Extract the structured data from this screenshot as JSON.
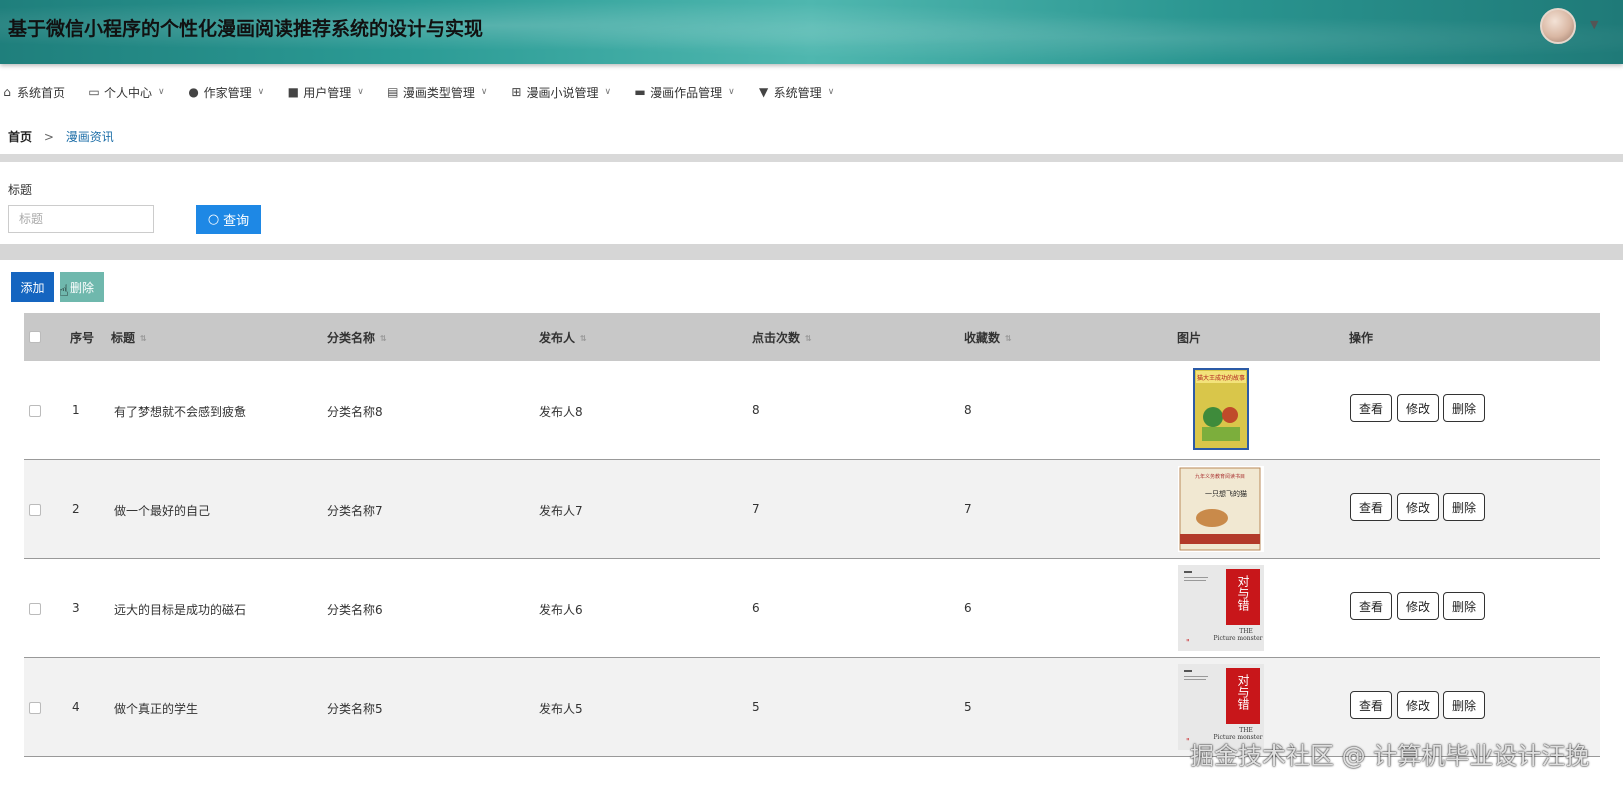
{
  "app": {
    "title": "基于微信小程序的个性化漫画阅读推荐系统的设计与实现"
  },
  "nav": {
    "items": [
      {
        "label": "系统首页",
        "icon": "home-icon",
        "dropdown": false
      },
      {
        "label": "个人中心",
        "icon": "id-card-icon",
        "dropdown": true
      },
      {
        "label": "作家管理",
        "icon": "person-icon",
        "dropdown": true
      },
      {
        "label": "用户管理",
        "icon": "briefcase-icon",
        "dropdown": true
      },
      {
        "label": "漫画类型管理",
        "icon": "clipboard-icon",
        "dropdown": true
      },
      {
        "label": "漫画小说管理",
        "icon": "grid-icon",
        "dropdown": true
      },
      {
        "label": "漫画作品管理",
        "icon": "chat-icon",
        "dropdown": true
      },
      {
        "label": "系统管理",
        "icon": "flag-icon",
        "dropdown": true
      }
    ]
  },
  "breadcrumb": {
    "home": "首页",
    "separator": ">",
    "current": "漫画资讯"
  },
  "search": {
    "label": "标题",
    "placeholder": "标题",
    "value": "",
    "button_label": "查询"
  },
  "actions": {
    "add_label": "添加",
    "delete_label": "删除"
  },
  "table": {
    "headers": {
      "index": "序号",
      "title": "标题",
      "category": "分类名称",
      "publisher": "发布人",
      "clicks": "点击次数",
      "favorites": "收藏数",
      "image": "图片",
      "ops": "操作"
    },
    "op_labels": {
      "view": "查看",
      "edit": "修改",
      "delete": "删除"
    },
    "rows": [
      {
        "index": "1",
        "title": "有了梦想就不会感到疲惫",
        "category": "分类名称8",
        "publisher": "发布人8",
        "clicks": "8",
        "favorites": "8",
        "cover": "green-book-cover"
      },
      {
        "index": "2",
        "title": "做一个最好的自己",
        "category": "分类名称7",
        "publisher": "发布人7",
        "clicks": "7",
        "favorites": "7",
        "cover": "cream-book-cover"
      },
      {
        "index": "3",
        "title": "远大的目标是成功的磁石",
        "category": "分类名称6",
        "publisher": "发布人6",
        "clicks": "6",
        "favorites": "6",
        "cover": "red-book-cover"
      },
      {
        "index": "4",
        "title": "做个真正的学生",
        "category": "分类名称5",
        "publisher": "发布人5",
        "clicks": "5",
        "favorites": "5",
        "cover": "red-book-cover"
      }
    ]
  },
  "covers": {
    "book1": {
      "title_text": "猫大王成功的故事"
    },
    "book2": {
      "top_text": "九年义务教育阅读书目",
      "title_text": "一只想飞的猫"
    },
    "book34": {
      "title_text": "对与错",
      "subtitle": "THE",
      "subtitle2": "Picture monster"
    }
  },
  "watermark": {
    "text": "掘金技术社区 @ 计算机毕业设计汪挽"
  },
  "colors": {
    "primary": "#1e88e5",
    "add": "#1565c0",
    "delete_disabled": "#6fb8ad",
    "header_teal": "#2b9b95",
    "breadcrumb_current": "#1e6fa8"
  }
}
